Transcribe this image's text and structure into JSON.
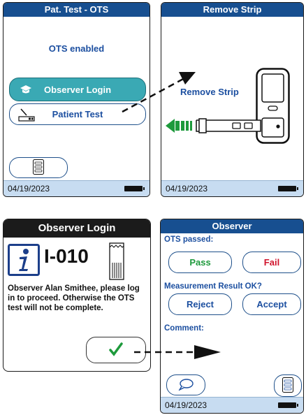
{
  "panel1": {
    "title": "Pat. Test - OTS",
    "status": "OTS enabled",
    "observer_login": "Observer Login",
    "patient_test": "Patient Test",
    "date": "04/19/2023"
  },
  "panel2": {
    "title": "Remove Strip",
    "message": "Remove Strip",
    "date": "04/19/2023"
  },
  "panel3": {
    "title": "Observer Login",
    "code": "I-010",
    "message": "Observer Alan Smithee, please log in to proceed. Otherwise the OTS test will not be complete."
  },
  "panel4": {
    "title": "Observer",
    "ots_passed_label": "OTS passed:",
    "pass": "Pass",
    "fail": "Fail",
    "result_ok_label": "Measurement Result OK?",
    "reject": "Reject",
    "accept": "Accept",
    "comment_label": "Comment:",
    "date": "04/19/2023"
  },
  "colors": {
    "header_blue": "#174f90",
    "highlight_teal": "#3aa9b4",
    "pass_green": "#1e9a3c",
    "fail_red": "#d0142c",
    "footer_blue": "#c7dcf1"
  }
}
